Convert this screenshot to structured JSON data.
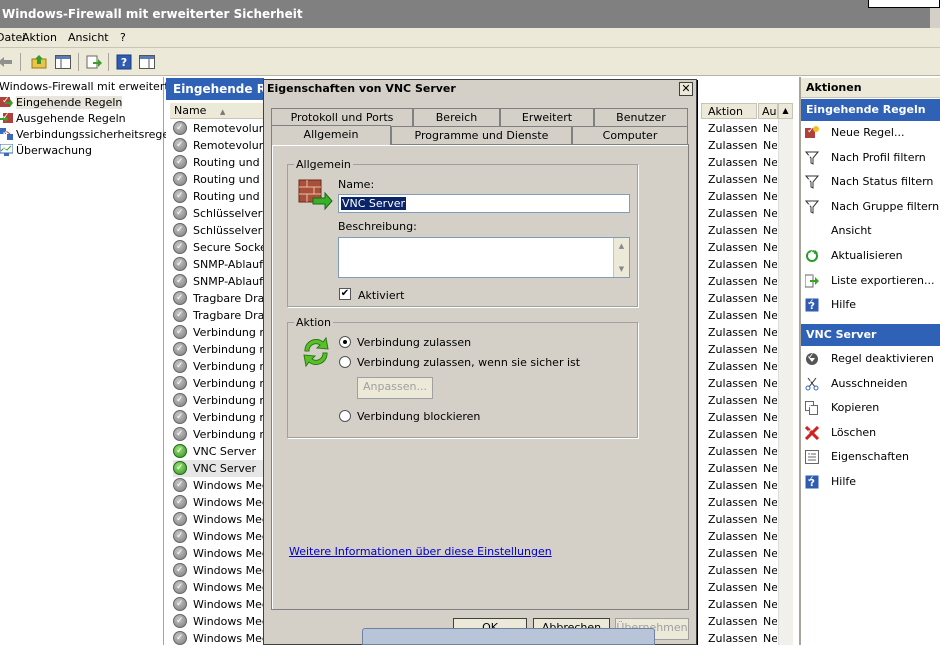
{
  "window": {
    "title": "Windows-Firewall mit erweiterter Sicherheit"
  },
  "menu": [
    "Datei",
    "Aktion",
    "Ansicht",
    "?"
  ],
  "toolbar": {
    "icons": [
      "back-arrow-icon",
      "forward-arrow-icon",
      "up-folder-icon",
      "show-hide-tree-icon",
      "export-list-icon",
      "help-icon",
      "show-hide-action-pane-icon"
    ]
  },
  "tree": {
    "root": "Windows-Firewall mit erweiterter S",
    "items": [
      {
        "label": "Eingehende Regeln",
        "selected": true
      },
      {
        "label": "Ausgehende Regeln"
      },
      {
        "label": "Verbindungssicherheitsregeln"
      },
      {
        "label": "Überwachung"
      }
    ]
  },
  "middle": {
    "header": "Eingehende Regeln",
    "columns": {
      "name": "Name",
      "action": "Aktion",
      "enabled": "Au"
    },
    "rows": [
      {
        "name": "Remotevolume",
        "action": "Zulassen",
        "enabled": "Ne",
        "icon": "gray"
      },
      {
        "name": "Remotevolume",
        "action": "Zulassen",
        "enabled": "Ne",
        "icon": "gray"
      },
      {
        "name": "Routing und Re",
        "action": "Zulassen",
        "enabled": "Ne",
        "icon": "gray"
      },
      {
        "name": "Routing und Re",
        "action": "Zulassen",
        "enabled": "Ne",
        "icon": "gray"
      },
      {
        "name": "Routing und Re",
        "action": "Zulassen",
        "enabled": "Ne",
        "icon": "gray"
      },
      {
        "name": "Schlüsselverwa",
        "action": "Zulassen",
        "enabled": "Ne",
        "icon": "gray"
      },
      {
        "name": "Schlüsselverwa",
        "action": "Zulassen",
        "enabled": "Ne",
        "icon": "gray"
      },
      {
        "name": "Secure Socket",
        "action": "Zulassen",
        "enabled": "Ne",
        "icon": "gray"
      },
      {
        "name": "SNMP-Ablaufve",
        "action": "Zulassen",
        "enabled": "Ne",
        "icon": "gray"
      },
      {
        "name": "SNMP-Ablaufve",
        "action": "Zulassen",
        "enabled": "Ne",
        "icon": "gray"
      },
      {
        "name": "Tragbare Draht",
        "action": "Zulassen",
        "enabled": "Ne",
        "icon": "gray"
      },
      {
        "name": "Tragbare Draht",
        "action": "Zulassen",
        "enabled": "Ne",
        "icon": "gray"
      },
      {
        "name": "Verbindung mit",
        "action": "Zulassen",
        "enabled": "Ne",
        "icon": "gray"
      },
      {
        "name": "Verbindung mit",
        "action": "Zulassen",
        "enabled": "Ne",
        "icon": "gray"
      },
      {
        "name": "Verbindung mit",
        "action": "Zulassen",
        "enabled": "Ne",
        "icon": "gray"
      },
      {
        "name": "Verbindung mit",
        "action": "Zulassen",
        "enabled": "Ne",
        "icon": "gray"
      },
      {
        "name": "Verbindung mit",
        "action": "Zulassen",
        "enabled": "Ne",
        "icon": "gray"
      },
      {
        "name": "Verbindung mit",
        "action": "Zulassen",
        "enabled": "Ne",
        "icon": "gray"
      },
      {
        "name": "Verbindung mit",
        "action": "Zulassen",
        "enabled": "Ne",
        "icon": "gray"
      },
      {
        "name": "VNC Server",
        "action": "Zulassen",
        "enabled": "Ne",
        "icon": "green"
      },
      {
        "name": "VNC Server",
        "action": "Zulassen",
        "enabled": "Ne",
        "icon": "green",
        "selected": true
      },
      {
        "name": "Windows Media",
        "action": "Zulassen",
        "enabled": "Ne",
        "icon": "gray"
      },
      {
        "name": "Windows Media",
        "action": "Zulassen",
        "enabled": "Ne",
        "icon": "gray"
      },
      {
        "name": "Windows Media",
        "action": "Zulassen",
        "enabled": "Ne",
        "icon": "gray"
      },
      {
        "name": "Windows Media",
        "action": "Zulassen",
        "enabled": "Ne",
        "icon": "gray"
      },
      {
        "name": "Windows Media",
        "action": "Zulassen",
        "enabled": "Ne",
        "icon": "gray"
      },
      {
        "name": "Windows Media",
        "action": "Zulassen",
        "enabled": "Ne",
        "icon": "gray"
      },
      {
        "name": "Windows Media",
        "action": "Zulassen",
        "enabled": "Ne",
        "icon": "gray"
      },
      {
        "name": "Windows Media",
        "action": "Zulassen",
        "enabled": "Ne",
        "icon": "gray"
      },
      {
        "name": "Windows Media",
        "action": "Zulassen",
        "enabled": "Ne",
        "icon": "gray"
      },
      {
        "name": "Windows Media",
        "action": "Zulassen",
        "enabled": "Ne",
        "icon": "gray"
      }
    ]
  },
  "actions": {
    "header": "Aktionen",
    "section1": {
      "title": "Eingehende Regeln",
      "items": [
        {
          "label": "Neue Regel...",
          "icon": "new-rule-icon"
        },
        {
          "label": "Nach Profil filtern",
          "icon": "filter-icon"
        },
        {
          "label": "Nach Status filtern",
          "icon": "filter-icon"
        },
        {
          "label": "Nach Gruppe filtern",
          "icon": "filter-icon"
        },
        {
          "label": "Ansicht",
          "icon": ""
        },
        {
          "label": "Aktualisieren",
          "icon": "refresh-icon"
        },
        {
          "label": "Liste exportieren...",
          "icon": "export-icon"
        },
        {
          "label": "Hilfe",
          "icon": "help-icon"
        }
      ]
    },
    "section2": {
      "title": "VNC Server",
      "items": [
        {
          "label": "Regel deaktivieren",
          "icon": "disable-icon"
        },
        {
          "label": "Ausschneiden",
          "icon": "cut-icon"
        },
        {
          "label": "Kopieren",
          "icon": "copy-icon"
        },
        {
          "label": "Löschen",
          "icon": "delete-icon"
        },
        {
          "label": "Eigenschaften",
          "icon": "properties-icon"
        },
        {
          "label": "Hilfe",
          "icon": "help-icon"
        }
      ]
    }
  },
  "dialog": {
    "title": "Eigenschaften von VNC Server",
    "tabs_back": [
      "Protokoll und Ports",
      "Bereich",
      "Erweitert",
      "Benutzer"
    ],
    "tabs_front": [
      "Allgemein",
      "Programme und Dienste",
      "Computer"
    ],
    "active_tab": "Allgemein",
    "general": {
      "legend": "Allgemein",
      "name_label": "Name:",
      "name_value": "VNC Server",
      "description_label": "Beschreibung:",
      "description_value": "",
      "enabled_label": "Aktiviert",
      "enabled": true
    },
    "action": {
      "legend": "Aktion",
      "options": [
        {
          "label": "Verbindung zulassen",
          "selected": true
        },
        {
          "label": "Verbindung zulassen, wenn sie sicher ist",
          "selected": false
        },
        {
          "label": "Verbindung blockieren",
          "selected": false
        }
      ],
      "customize_label": "Anpassen..."
    },
    "more_info_link": "Weitere Informationen über diese Einstellungen",
    "buttons": {
      "ok": "OK",
      "cancel": "Abbrechen",
      "apply": "Übernehmen"
    }
  },
  "colors": {
    "header_blue": "#2f61b6",
    "dialog_gray": "#d4d0c8",
    "link": "#0000cc"
  }
}
